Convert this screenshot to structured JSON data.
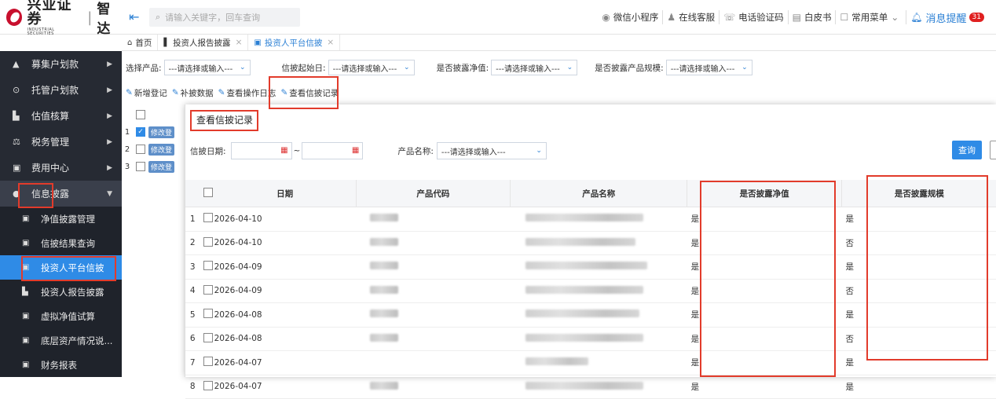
{
  "brand": {
    "name_cn": "兴业证券",
    "name_en": "INDUSTRIAL SECURITIES",
    "sub": "智达"
  },
  "search": {
    "placeholder": "请输入关键字，回车查询"
  },
  "toolbar": [
    {
      "icon": "wechat-icon",
      "label": "微信小程序"
    },
    {
      "icon": "support-icon",
      "label": "在线客服"
    },
    {
      "icon": "phone-icon",
      "label": "电话验证码"
    },
    {
      "icon": "book-icon",
      "label": "白皮书"
    },
    {
      "icon": "menu-icon",
      "label": "常用菜单"
    },
    {
      "icon": "bell-icon",
      "label": "消息提醒",
      "badge": "31"
    }
  ],
  "tabs": [
    {
      "icon": "home-icon",
      "label": "首页"
    },
    {
      "icon": "doc-icon",
      "label": "投资人报告披露"
    },
    {
      "icon": "doc-icon",
      "label": "投资人平台信披"
    }
  ],
  "sidebar": {
    "items": [
      {
        "icon": "bell-icon",
        "label": "募集户划款"
      },
      {
        "icon": "gear-icon",
        "label": "托管户划款"
      },
      {
        "icon": "chart-icon",
        "label": "估值核算"
      },
      {
        "icon": "scale-icon",
        "label": "税务管理"
      },
      {
        "icon": "doc-icon",
        "label": "费用中心"
      },
      {
        "icon": "info-icon",
        "label": "信息披露"
      }
    ],
    "subitems": [
      {
        "label": "净值披露管理"
      },
      {
        "label": "信披结果查询"
      },
      {
        "label": "投资人平台信披"
      },
      {
        "label": "投资人报告披露"
      },
      {
        "label": "虚拟净值试算"
      },
      {
        "label": "底层资产情况说..."
      },
      {
        "label": "财务报表"
      }
    ]
  },
  "filters": [
    {
      "label": "选择产品:",
      "value": "---请选择或输入---"
    },
    {
      "label": "信披起始日:",
      "value": "---请选择或输入---"
    },
    {
      "label": "是否披露净值:",
      "value": "---请选择或输入---"
    },
    {
      "label": "是否披露产品规模:",
      "value": "---请选择或输入---"
    }
  ],
  "actions": [
    "新增登记",
    "补披数据",
    "查看操作日志",
    "查看信披记录"
  ],
  "bg_rows": [
    {
      "num": "1",
      "btn": "修改登"
    },
    {
      "num": "2",
      "btn": "修改登"
    },
    {
      "num": "3",
      "btn": "修改登"
    }
  ],
  "modal": {
    "title": "查看信披记录",
    "date_label": "信披日期:",
    "date_sep": "~",
    "product_label": "产品名称:",
    "product_value": "---请选择或输入---",
    "query_label": "查询",
    "columns": [
      "日期",
      "产品代码",
      "产品名称",
      "是否披露净值",
      "是否披露规模"
    ],
    "rows": [
      {
        "num": "1",
        "date": "2026-04-10",
        "nav": "是",
        "scale": "是"
      },
      {
        "num": "2",
        "date": "2026-04-10",
        "nav": "是",
        "scale": "否"
      },
      {
        "num": "3",
        "date": "2026-04-09",
        "nav": "是",
        "scale": "是"
      },
      {
        "num": "4",
        "date": "2026-04-09",
        "nav": "是",
        "scale": "否"
      },
      {
        "num": "5",
        "date": "2026-04-08",
        "nav": "是",
        "scale": "是"
      },
      {
        "num": "6",
        "date": "2026-04-08",
        "nav": "是",
        "scale": "否"
      },
      {
        "num": "7",
        "date": "2026-04-07",
        "nav": "是",
        "scale": "是"
      },
      {
        "num": "8",
        "date": "2026-04-07",
        "nav": "是",
        "scale": "是"
      }
    ]
  },
  "colors": {
    "sidebar_bg": "#262a33",
    "accent": "#2f8be6",
    "highlight": "#e23b2b"
  }
}
